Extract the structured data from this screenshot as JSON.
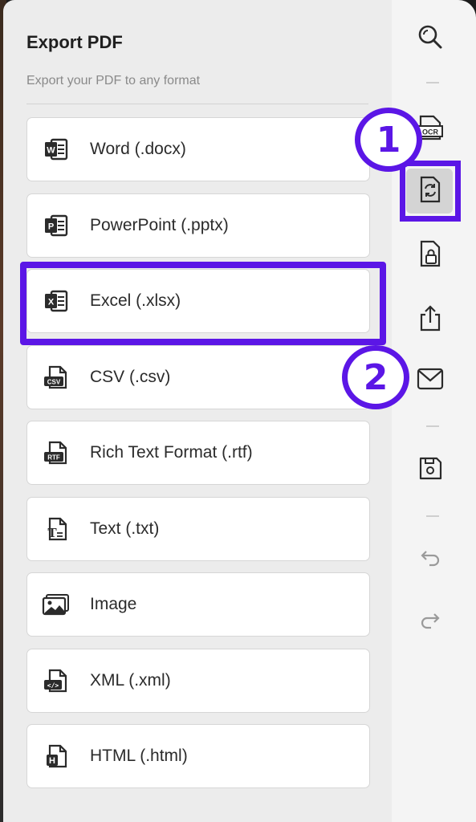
{
  "panel": {
    "title": "Export PDF",
    "subtitle": "Export your PDF to any format"
  },
  "options": [
    {
      "label": "Word (.docx)",
      "icon": "word-icon",
      "badge": "W"
    },
    {
      "label": "PowerPoint (.pptx)",
      "icon": "powerpoint-icon",
      "badge": "P"
    },
    {
      "label": "Excel (.xlsx)",
      "icon": "excel-icon",
      "badge": "X"
    },
    {
      "label": "CSV (.csv)",
      "icon": "csv-file-icon",
      "badge": "CSV"
    },
    {
      "label": "Rich Text Format (.rtf)",
      "icon": "rtf-file-icon",
      "badge": "RTF"
    },
    {
      "label": "Text (.txt)",
      "icon": "text-file-icon",
      "badge": "T"
    },
    {
      "label": "Image",
      "icon": "image-icon"
    },
    {
      "label": "XML (.xml)",
      "icon": "xml-file-icon",
      "badge": "</>"
    },
    {
      "label": "HTML (.html)",
      "icon": "html-file-icon",
      "badge": "H"
    }
  ],
  "toolbar": {
    "ocr_label": "OCR",
    "items": [
      "search-icon",
      "ocr-icon",
      "convert-icon",
      "protect-icon",
      "share-icon",
      "mail-icon",
      "save-icon",
      "undo-icon",
      "redo-icon"
    ]
  },
  "annotations": {
    "step1": "1",
    "step2": "2"
  },
  "colors": {
    "accent": "#5b16e6",
    "panel_bg": "#ececec",
    "toolbar_bg": "#f4f4f4"
  }
}
